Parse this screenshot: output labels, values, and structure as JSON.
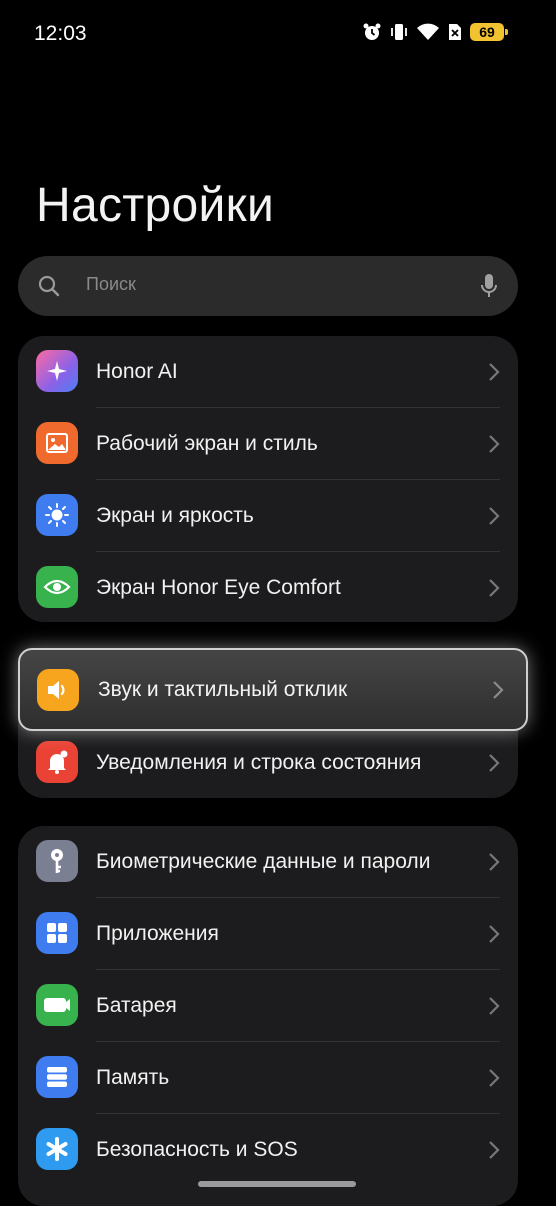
{
  "status_bar": {
    "time": "12:03",
    "battery": "69"
  },
  "title": "Настройки",
  "search": {
    "placeholder": "Поиск"
  },
  "group1": [
    {
      "label": "Honor AI",
      "icon": "honor-ai-icon",
      "color": "#8a62e8"
    },
    {
      "label": "Рабочий экран и стиль",
      "icon": "image-icon",
      "color": "#ef6a2c"
    },
    {
      "label": "Экран и яркость",
      "icon": "sun-icon",
      "color": "#3f7cf0"
    },
    {
      "label": "Экран Honor Eye Comfort",
      "icon": "eye-icon",
      "color": "#37b24d"
    }
  ],
  "highlighted": {
    "label": "Звук и тактильный отклик",
    "icon": "speaker-icon",
    "color": "#f7a51e"
  },
  "group2": [
    {
      "label": "Уведомления и строка состояния",
      "icon": "bell-icon",
      "color": "#ea4335"
    }
  ],
  "group3": [
    {
      "label": "Биометрические данные и пароли",
      "icon": "key-icon",
      "color": "#7a7f92"
    },
    {
      "label": "Приложения",
      "icon": "apps-grid-icon",
      "color": "#3f7cf0"
    },
    {
      "label": "Батарея",
      "icon": "battery-icon",
      "color": "#37b24d"
    },
    {
      "label": "Память",
      "icon": "storage-icon",
      "color": "#3f7cf0"
    },
    {
      "label": "Безопасность и SOS",
      "icon": "asterisk-icon",
      "color": "#2f9bf0"
    }
  ]
}
